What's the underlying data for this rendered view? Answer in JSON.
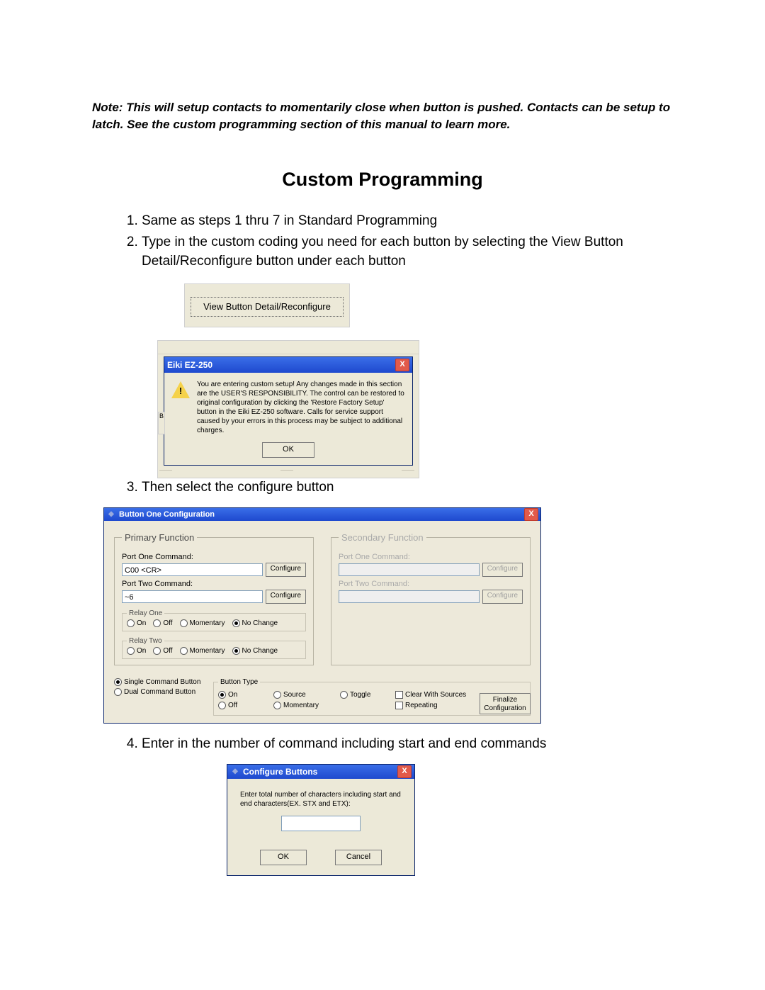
{
  "note": "Note: This will setup contacts to momentarily close when button is pushed. Contacts can be setup to latch. See the custom programming section of this manual to learn more.",
  "heading": "Custom Programming",
  "steps": {
    "s1": "Same as steps 1 thru 7 in Standard Programming",
    "s2": "Type in the custom coding you need for each button by selecting the View Button Detail/Reconfigure button under each button",
    "s3": "Then select the configure button",
    "s4": "Enter in the number of command including start and end commands"
  },
  "fig1": {
    "button_label": "View Button Detail/Reconfigure"
  },
  "fig2": {
    "title": "Eiki EZ-250",
    "close_label": "X",
    "side_char": "B",
    "message": "You are entering custom setup!  Any changes made in this section are the USER'S RESPONSIBILITY.  The control can be restored to original configuration by clicking the 'Restore Factory Setup' button in the Eiki EZ-250 software.  Calls for service support caused by your errors in this process may be subject to additional charges.",
    "ok_label": "OK"
  },
  "fig3": {
    "title": "Button One Configuration",
    "close_label": "X",
    "primary": {
      "legend": "Primary Function",
      "port1_label": "Port One Command:",
      "port1_value": "C00 <CR>",
      "port2_label": "Port Two Command:",
      "port2_value": "~6",
      "configure_label": "Configure"
    },
    "secondary": {
      "legend": "Secondary Function",
      "port1_label": "Port One Command:",
      "port2_label": "Port Two Command:",
      "configure_label": "Configure"
    },
    "relay": {
      "r1_legend": "Relay One",
      "r2_legend": "Relay Two",
      "on": "On",
      "off": "Off",
      "momentary": "Momentary",
      "nochange": "No Change"
    },
    "cmdtype": {
      "single": "Single Command Button",
      "dual": "Dual Command Button"
    },
    "btype": {
      "legend": "Button Type",
      "on": "On",
      "off": "Off",
      "source": "Source",
      "momentary": "Momentary",
      "toggle": "Toggle",
      "clear": "Clear With Sources",
      "repeating": "Repeating"
    },
    "finalize_label": "Finalize Configuration"
  },
  "fig4": {
    "title": "Configure Buttons",
    "close_label": "X",
    "prompt": "Enter total number of characters including start and end characters(EX.  STX and ETX):",
    "ok_label": "OK",
    "cancel_label": "Cancel"
  }
}
